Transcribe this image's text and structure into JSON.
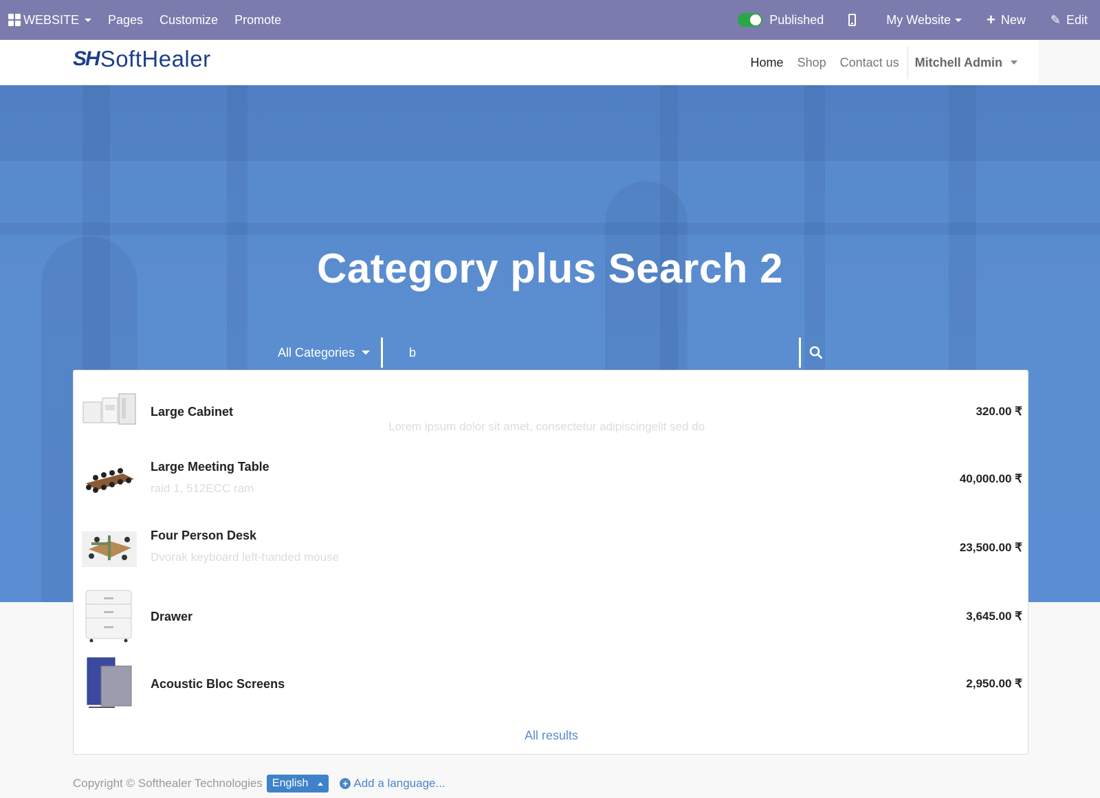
{
  "adminbar": {
    "website_label": "WEBSITE",
    "pages_label": "Pages",
    "customize_label": "Customize",
    "promote_label": "Promote",
    "published_label": "Published",
    "my_website_label": "My Website",
    "new_label": "New",
    "edit_label": "Edit",
    "icons": [
      "apps-grid-icon",
      "mobile-preview-icon",
      "plus-icon",
      "pencil-icon"
    ]
  },
  "header": {
    "logo_mark": "SH",
    "logo_text": "SoftHealer",
    "nav": [
      "Home",
      "Shop",
      "Contact us"
    ],
    "user": "Mitchell Admin"
  },
  "hero": {
    "title": "Category plus Search 2"
  },
  "search": {
    "category": "All Categories",
    "query": "b",
    "icon": "search-icon"
  },
  "results": {
    "items": [
      {
        "name": "Large Cabinet",
        "desc": "",
        "price": "320.00 ₹"
      },
      {
        "name": "Large Meeting Table",
        "desc": "raid 1, 512ECC ram",
        "price": "40,000.00 ₹"
      },
      {
        "name": "Four Person Desk",
        "desc": "Dvorak keyboard left-handed mouse",
        "price": "23,500.00 ₹"
      },
      {
        "name": "Drawer",
        "desc": "",
        "price": "3,645.00 ₹"
      },
      {
        "name": "Acoustic Bloc Screens",
        "desc": "",
        "price": "2,950.00 ₹"
      }
    ],
    "lorem": "Lorem ipsum dolor sit amet, consectetur adipiscingelit sed do",
    "all_results": "All results"
  },
  "footer": {
    "copyright": "Copyright © Softhealer Technologies",
    "language": "English",
    "add_language": "Add a language..."
  },
  "colors": {
    "adminbar": "#7c7bad",
    "hero": "#5a8dd2",
    "toggle_on": "#28a745",
    "link": "#5a8ecf",
    "logo": "#1d3f8a"
  }
}
